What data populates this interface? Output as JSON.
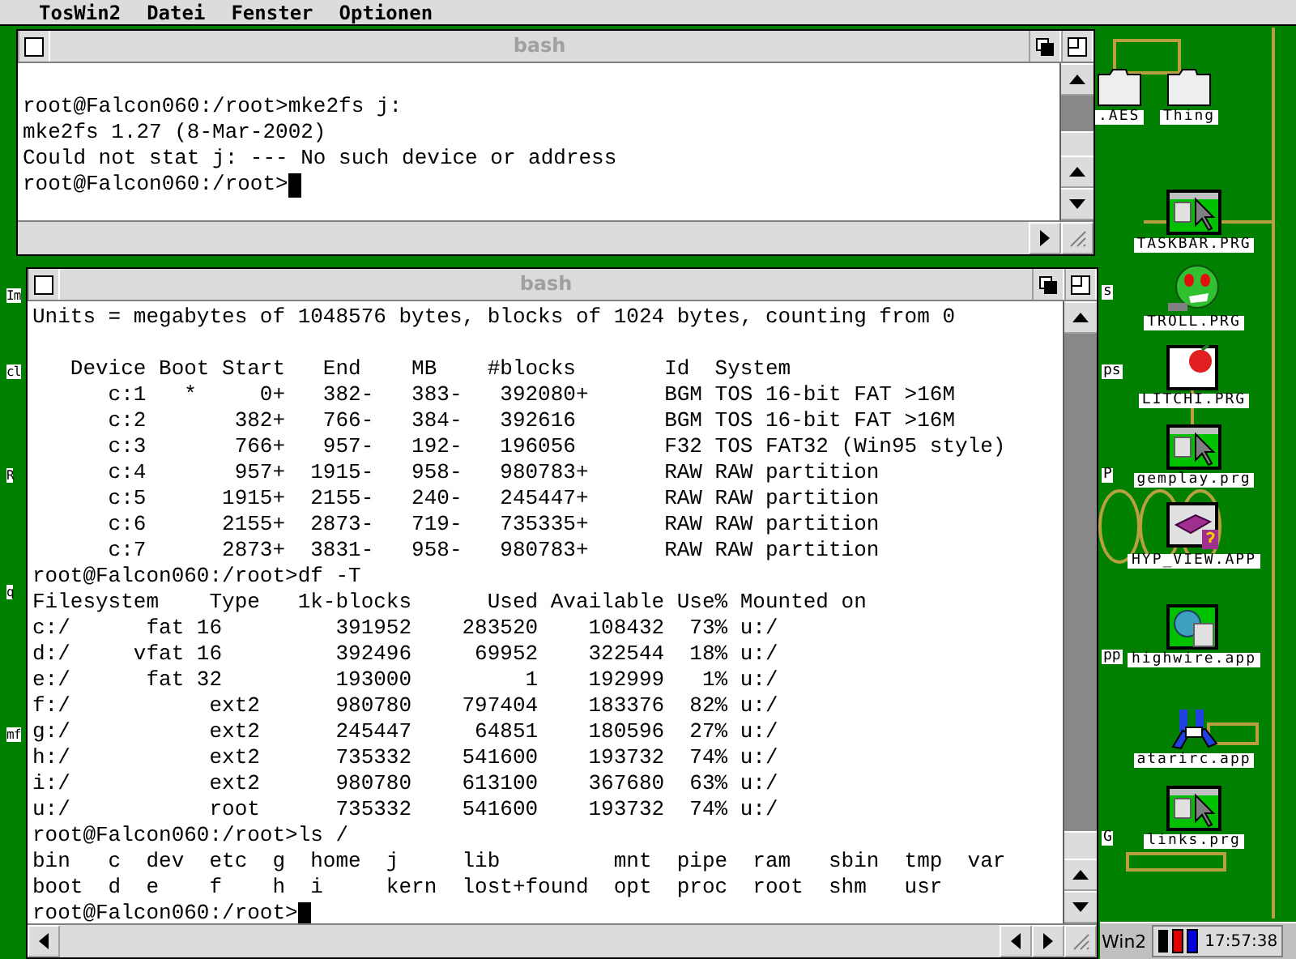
{
  "menu_bar": {
    "app_name": "TosWin2",
    "items": [
      "Datei",
      "Fenster",
      "Optionen"
    ]
  },
  "windows": [
    {
      "title": "bash",
      "cursor": true,
      "blocks": [
        [
          "root@Falcon060:/root>mke2fs j:",
          "mke2fs 1.27 (8-Mar-2002)",
          "Could not stat j: --- No such device or address",
          "root@Falcon060:/root>"
        ]
      ]
    },
    {
      "title": "bash",
      "cursor": true,
      "blocks": [
        [
          "Units = megabytes of 1048576 bytes, blocks of 1024 bytes, counting from 0"
        ],
        [
          "   Device Boot Start   End    MB    #blocks       Id  System",
          "      c:1   *     0+   382-   383-   392080+      BGM TOS 16-bit FAT >16M",
          "      c:2       382+   766-   384-   392616       BGM TOS 16-bit FAT >16M",
          "      c:3       766+   957-   192-   196056       F32 TOS FAT32 (Win95 style)",
          "      c:4       957+  1915-   958-   980783+      RAW RAW partition",
          "      c:5      1915+  2155-   240-   245447+      RAW RAW partition",
          "      c:6      2155+  2873-   719-   735335+      RAW RAW partition",
          "      c:7      2873+  3831-   958-   980783+      RAW RAW partition",
          "root@Falcon060:/root>df -T",
          "Filesystem    Type   1k-blocks      Used Available Use% Mounted on",
          "c:/      fat 16         391952    283520    108432  73% u:/",
          "d:/     vfat 16         392496     69952    322544  18% u:/",
          "e:/      fat 32         193000         1    192999   1% u:/",
          "f:/           ext2      980780    797404    183376  82% u:/",
          "g:/           ext2      245447     64851    180596  27% u:/",
          "h:/           ext2      735332    541600    193732  74% u:/",
          "i:/           ext2      980780    613100    367680  63% u:/",
          "u:/           root      735332    541600    193732  74% u:/",
          "root@Falcon060:/root>ls /",
          "bin   c  dev  etc  g  home  j     lib         mnt  pipe  ram   sbin  tmp  var",
          "boot  d  e    f    h  i     kern  lost+found  opt  proc  root  shm   usr",
          "root@Falcon060:/root>"
        ]
      ]
    }
  ],
  "top_icons": [
    {
      "label": ".AES",
      "kind": "folder"
    },
    {
      "label": "Thing",
      "kind": "folder"
    }
  ],
  "desktop_icons": [
    {
      "label": "TASKBAR.PRG",
      "kind": "program"
    },
    {
      "label": "TROLL.PRG",
      "kind": "troll"
    },
    {
      "label": "LITCHI.PRG",
      "kind": "fruit"
    },
    {
      "label": "gemplay.prg",
      "kind": "program"
    },
    {
      "label": "HYP_VIEW.APP",
      "kind": "book"
    },
    {
      "label": "highwire.app",
      "kind": "globe"
    },
    {
      "label": "atarirc.app",
      "kind": "figures"
    },
    {
      "label": "links.prg",
      "kind": "program"
    }
  ],
  "cut_labels_left": [
    "Im",
    "cl",
    "R",
    "q",
    "mf"
  ],
  "cut_labels_right": [
    "s",
    "ps",
    "P",
    "pp",
    "G"
  ],
  "taskbar": {
    "button": "Win2",
    "clock": "17:57:38"
  }
}
